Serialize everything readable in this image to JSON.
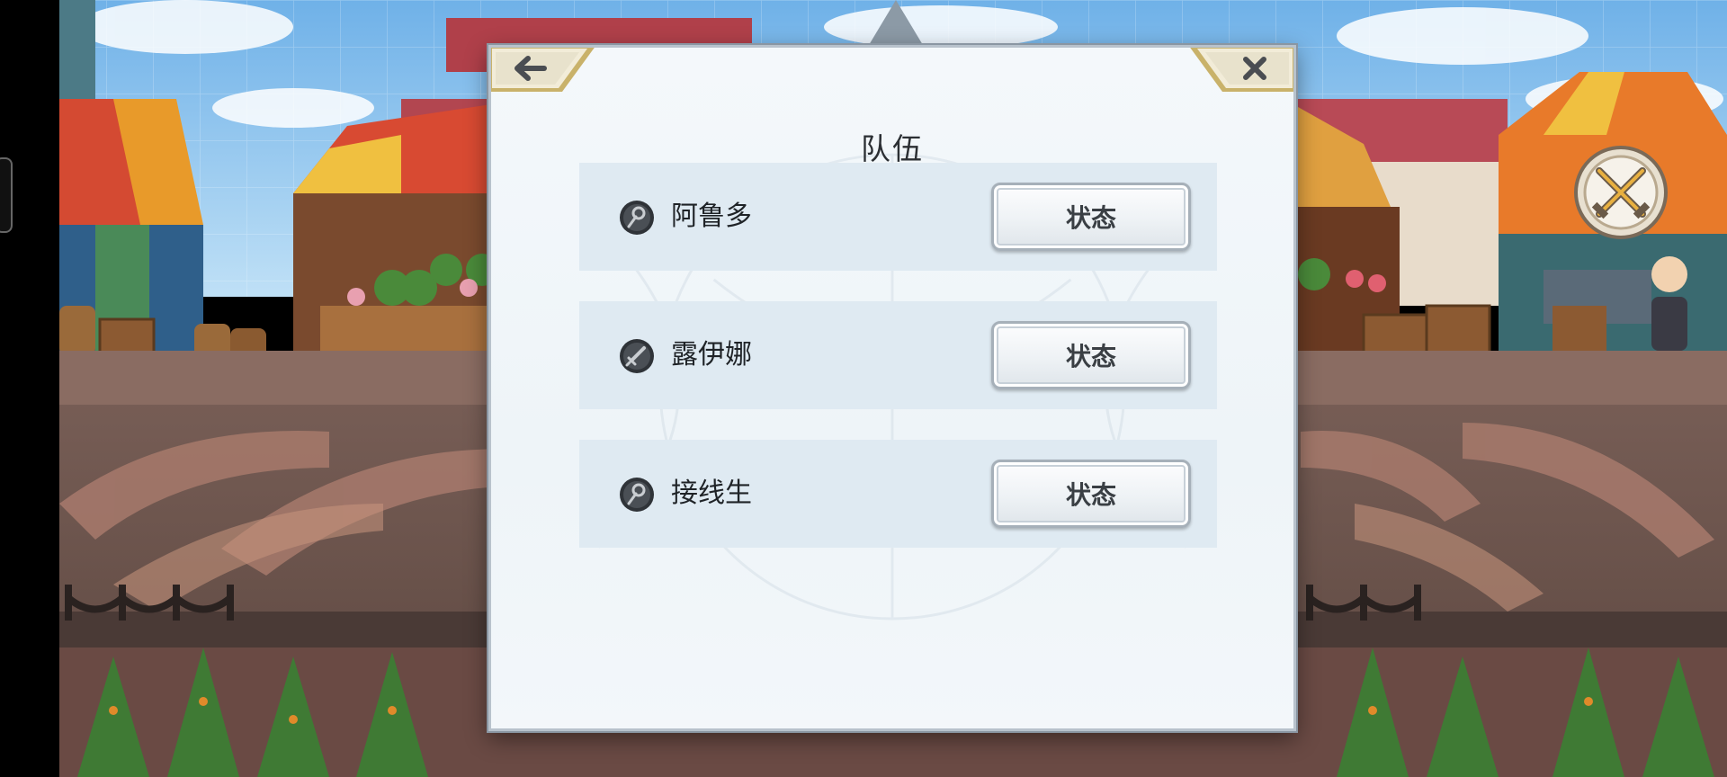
{
  "dialog": {
    "title": "队伍",
    "back_icon": "arrow-left-icon",
    "close_icon": "close-icon"
  },
  "members": [
    {
      "name": "阿鲁多",
      "class_icon": "wand-class-icon",
      "status_label": "状态"
    },
    {
      "name": "露伊娜",
      "class_icon": "sword-class-icon",
      "status_label": "状态"
    },
    {
      "name": "接线生",
      "class_icon": "wand-class-icon",
      "status_label": "状态"
    }
  ],
  "hud": {
    "battle_icon": "crossed-swords-icon"
  },
  "colors": {
    "accent_gold": "#c9b26a",
    "dialog_bg": "#f1f6fa",
    "row_bg": "#dfeaf2"
  }
}
